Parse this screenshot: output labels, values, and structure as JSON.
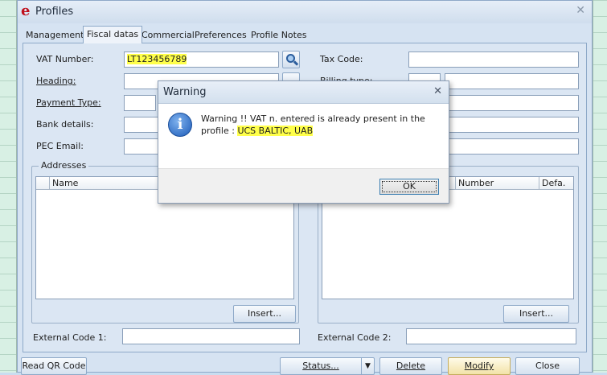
{
  "window": {
    "title": "Profiles",
    "logo": "e",
    "close_icon": "close-icon"
  },
  "tabs": [
    {
      "label": "Management"
    },
    {
      "label": "Fiscal datas"
    },
    {
      "label": "Commercial"
    },
    {
      "label": "Preferences"
    },
    {
      "label": "Profile Notes"
    }
  ],
  "form": {
    "vat_label": "VAT Number:",
    "vat_value": "LT123456789",
    "heading_label": "Heading:",
    "payment_label": "Payment Type:",
    "bank_label": "Bank details:",
    "pec_label": "PEC Email:",
    "tax_label": "Tax Code:",
    "billing_label": "Billing type:"
  },
  "addresses": {
    "legend": "Addresses",
    "columns": [
      "Name"
    ],
    "insert_label": "Insert..."
  },
  "right_list": {
    "columns": [
      "Number",
      "Defa."
    ],
    "insert_label": "Insert..."
  },
  "external": {
    "code1_label": "External Code 1:",
    "code2_label": "External Code 2:"
  },
  "buttons": {
    "read_qr": "Read QR Code",
    "status": "Status...",
    "delete": "Delete",
    "modify": "Modify",
    "close": "Close"
  },
  "dialog": {
    "title": "Warning",
    "line1": "Warning !! VAT n. entered is already present in the",
    "line2_prefix": "profile : ",
    "line2_highlight": "UCS BALTIC, UAB",
    "ok": "OK",
    "icon": "info-icon"
  },
  "colors": {
    "highlight": "#ffff4a",
    "logo": "#c0101c"
  }
}
